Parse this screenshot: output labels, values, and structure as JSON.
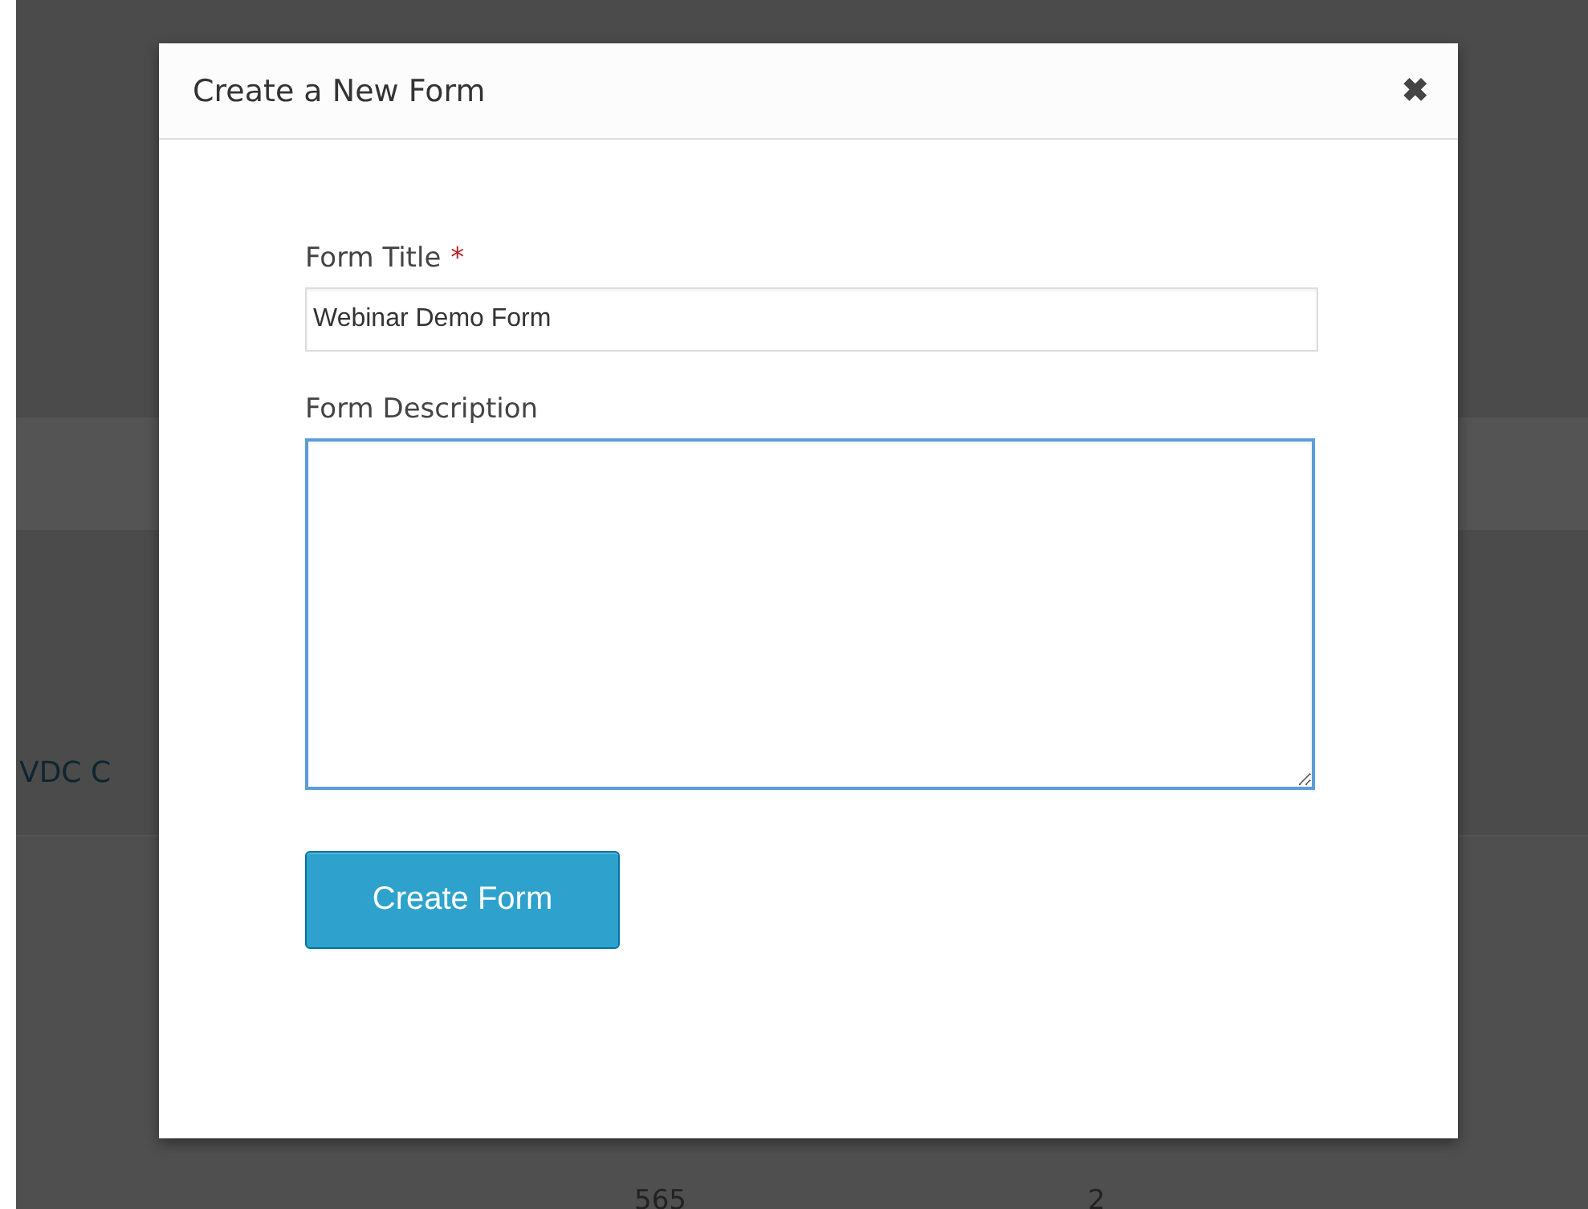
{
  "background": {
    "row_label": "VDC C",
    "cells": [
      "565",
      "2"
    ]
  },
  "dialog": {
    "title": "Create a New Form",
    "close": "✖",
    "fields": [
      {
        "kind": "text",
        "label": "Form Title",
        "required_mark": "*",
        "value": "Webinar Demo Form",
        "focused": false
      },
      {
        "kind": "textarea",
        "label": "Form Description",
        "focused": true
      }
    ],
    "submit": "Create Form"
  }
}
